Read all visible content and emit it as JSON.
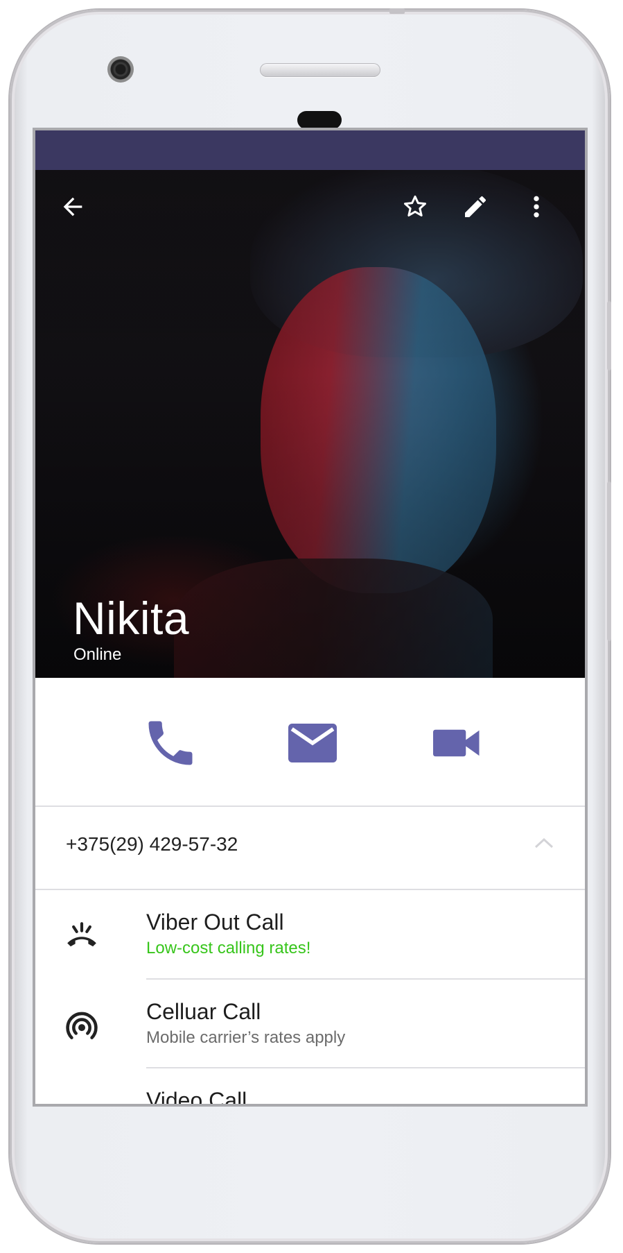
{
  "contact": {
    "name": "Nikita",
    "status": "Online",
    "phone_number": "+375(29) 429-57-32"
  },
  "toolbar": {
    "icons": [
      "back-arrow-icon",
      "star-icon",
      "edit-pencil-icon",
      "more-vert-icon"
    ]
  },
  "actions": {
    "icons": [
      "phone-icon",
      "message-icon",
      "video-camera-icon"
    ],
    "color": "#6464ac"
  },
  "options": [
    {
      "title": "Viber Out Call",
      "subtitle": "Low-cost calling rates!",
      "icon": "viber-out-icon",
      "subtitle_color": "#37c51b"
    },
    {
      "title": "Celluar Call",
      "subtitle": "Mobile carrier’s rates apply",
      "icon": "cellular-signal-icon"
    },
    {
      "title": "Video Call",
      "subtitle": "",
      "icon": "video-icon"
    }
  ],
  "colors": {
    "status_bar": "#3b3861",
    "accent": "#6464ac",
    "green": "#37c51b"
  }
}
